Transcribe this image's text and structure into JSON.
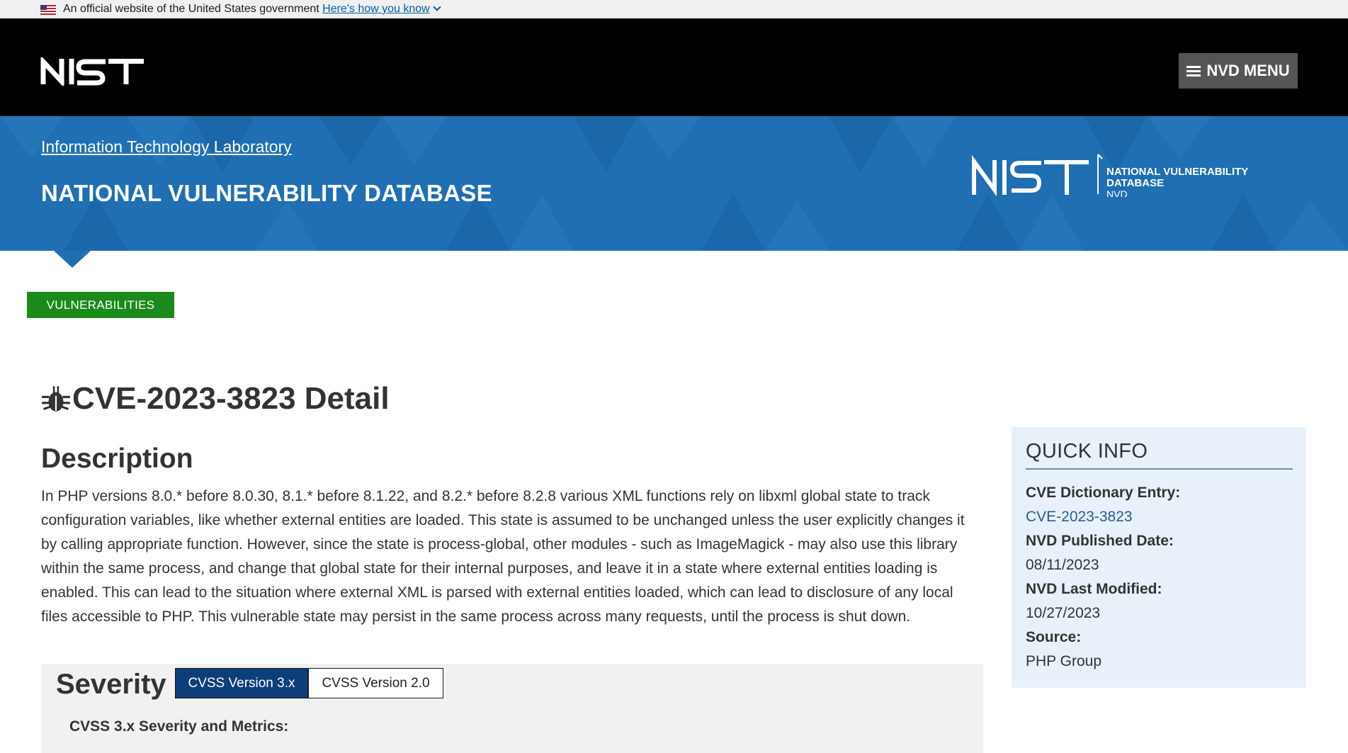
{
  "gov_banner": {
    "text": "An official website of the United States government",
    "link": "Here's how you know"
  },
  "header": {
    "menu_button": "NVD MENU"
  },
  "banner": {
    "lab_link": "Information Technology Laboratory",
    "title": "NATIONAL VULNERABILITY DATABASE",
    "logo_line1": "NATIONAL VULNERABILITY",
    "logo_line2": "DATABASE",
    "logo_line3": "NVD"
  },
  "nav": {
    "tab": "VULNERABILITIES"
  },
  "page": {
    "title": "CVE-2023-3823 Detail"
  },
  "description": {
    "heading": "Description",
    "text": "In PHP versions 8.0.* before 8.0.30, 8.1.* before 8.1.22, and 8.2.* before 8.2.8 various XML functions rely on libxml global state to track configuration variables, like whether external entities are loaded. This state is assumed to be unchanged unless the user explicitly changes it by calling appropriate function. However, since the state is process-global, other modules - such as ImageMagick - may also use this library within the same process, and change that global state for their internal purposes, and leave it in a state where external entities loading is enabled. This can lead to the situation where external XML is parsed with external entities loaded, which can lead to disclosure of any local files accessible to PHP. This vulnerable state may persist in the same process across many requests, until the process is shut down."
  },
  "severity": {
    "heading": "Severity",
    "tab_v3": "CVSS Version 3.x",
    "tab_v2": "CVSS Version 2.0",
    "subheading": "CVSS 3.x Severity and Metrics:"
  },
  "quick_info": {
    "title": "QUICK INFO",
    "cve_label": "CVE Dictionary Entry:",
    "cve_value": "CVE-2023-3823",
    "published_label": "NVD Published Date:",
    "published_value": "08/11/2023",
    "modified_label": "NVD Last Modified:",
    "modified_value": "10/27/2023",
    "source_label": "Source:",
    "source_value": "PHP Group"
  },
  "colors": {
    "header_bg": "#000000",
    "banner_blue": "#1f6fb2",
    "vuln_tab_green": "#1a8a1a",
    "active_tab": "#0c3f79",
    "quick_info_bg": "#e8f1fa"
  },
  "icons": [
    "us-flag-icon",
    "chevron-down-icon",
    "hamburger-icon",
    "bug-icon"
  ]
}
